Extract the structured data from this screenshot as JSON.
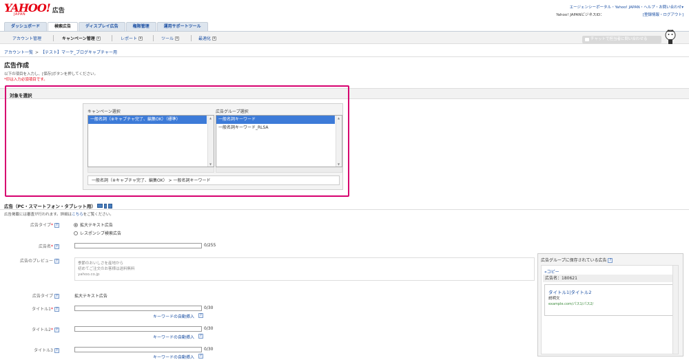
{
  "header": {
    "logo_text": "YAHOO!",
    "logo_sub": "JAPAN",
    "logo_suffix": "広告",
    "top_links": "エージェンシーポータル・Yahoo! JAPAN・ヘルプ・お問い合わせ▾",
    "biz_id_label": "Yahoo! JAPANビジネスID：",
    "account_links": "[登録情報・ログアウト]"
  },
  "tabs": [
    {
      "label": "ダッシュボード"
    },
    {
      "label": "検索広告"
    },
    {
      "label": "ディスプレイ広告"
    },
    {
      "label": "権限管理"
    },
    {
      "label": "運用サポートツール"
    }
  ],
  "subnav": {
    "items": [
      "アカウント管理",
      "キャンペーン管理",
      "レポート",
      "ツール",
      "最適化"
    ],
    "chat_button": "チャットで担当者に問い合わせる"
  },
  "breadcrumb": {
    "root": "アカウント一覧",
    "current": "【テスト】マーケ_ブログキャプチャー用"
  },
  "page": {
    "title": "広告作成",
    "instruction": "以下の項目を入力し、[保存]ボタンを押してください。",
    "required_note": "*印は入力必須項目です。"
  },
  "target": {
    "section_title": "対象を選択",
    "campaign_label": "キャンペーン選択",
    "adgroup_label": "広告グループ選択",
    "campaigns": [
      "一般名詞（※キャプチャ完了、編集OK）（標準）"
    ],
    "adgroups": [
      "一般名詞キーワード",
      "一般名詞キーワード_RLSA"
    ],
    "selected_path": "一般名詞（※キャプチャ完了、編集OK） > 一般名詞キーワード"
  },
  "ad": {
    "section_title": "広告（PC・スマートフォン・タブレット用）",
    "note": "広告掲載には審査が行われます。詳細は",
    "note_link": "こちら",
    "note_end": "をご覧ください。",
    "type_label": "広告タイプ",
    "type_options": [
      "拡大テキスト広告",
      "レスポンシブ検索広告"
    ],
    "name_label": "広告名",
    "name_value": "",
    "name_count": "0/255",
    "preview_label": "広告のプレビュー",
    "preview_lines": [
      "季節のおいしさを産地から",
      "初めてご注文のお客様は送料無料",
      "yahoo.co.jp"
    ],
    "adtype_label": "広告タイプ",
    "adtype_value": "拡大テキスト広告",
    "title1_label": "タイトル1",
    "title2_label": "タイトル2",
    "title3_label": "タイトル3",
    "title_count": "0/30",
    "keyword_insert": "キーワードの自動挿入"
  },
  "saved_ads": {
    "title": "広告グループに保存されている広告",
    "copy_link": "«コピー",
    "ad_name": "広告名：180621",
    "ad_title": "タイトル1|タイトル2",
    "ad_desc": "説明文",
    "ad_url": "example.com/パス1/パス2/"
  }
}
